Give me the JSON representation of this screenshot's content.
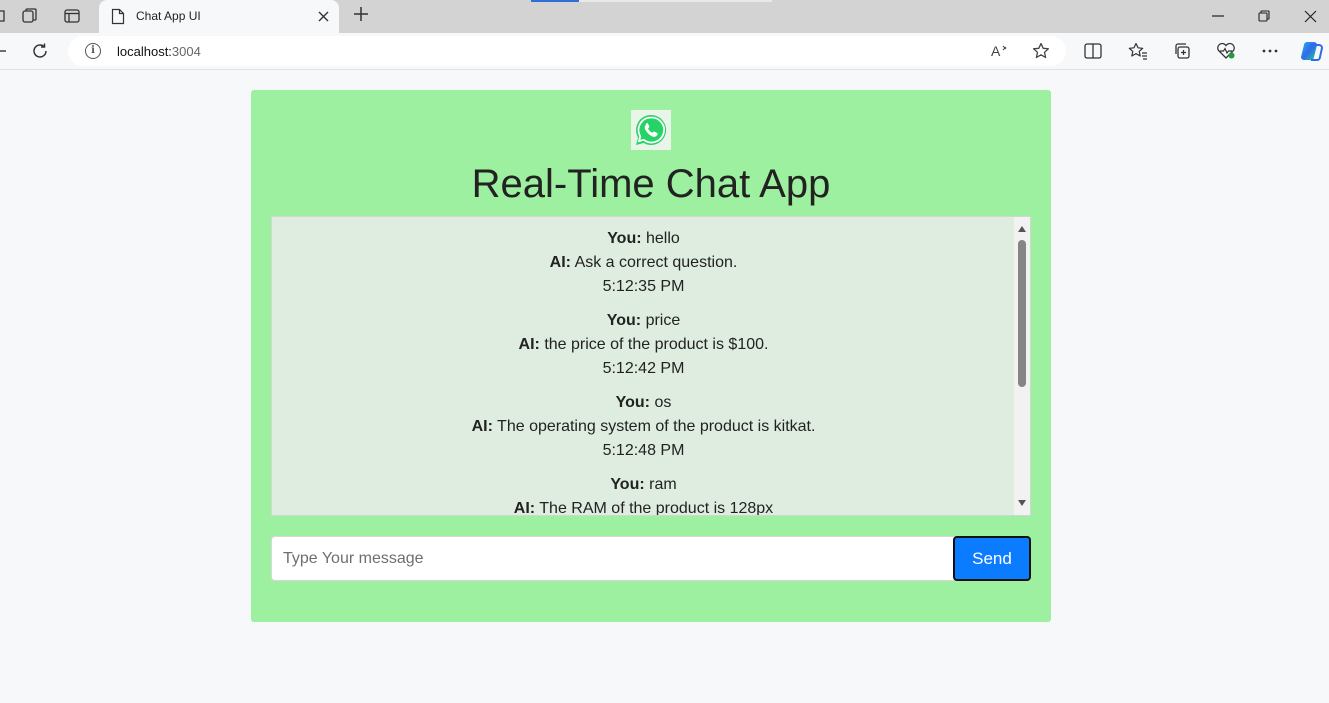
{
  "browser": {
    "tab_title": "Chat App UI",
    "url_host": "localhost:",
    "url_port": "3004"
  },
  "icons": {
    "workspaces": "workspaces-icon",
    "tab_actions": "tab-actions-icon",
    "page": "page-icon",
    "close": "close-icon",
    "new_tab": "plus-icon",
    "refresh": "refresh-icon",
    "info": "info-icon",
    "read_aloud": "read-aloud-icon",
    "favorite": "star-icon",
    "split": "split-screen-icon",
    "favorites": "favorites-icon",
    "collections": "collections-icon",
    "health": "browser-essentials-icon",
    "more": "more-icon",
    "copilot": "copilot-icon",
    "logo": "whatsapp-icon"
  },
  "colors": {
    "card": "#9cf09f",
    "chat_bg": "#dfede0",
    "send": "#0b7bff",
    "whatsapp": "#25d366"
  },
  "app": {
    "title": "Real-Time Chat App",
    "messages": [
      {
        "you_label": "You:",
        "you": "hello",
        "ai_label": "AI:",
        "ai": "Ask a correct question.",
        "time": "5:12:35 PM"
      },
      {
        "you_label": "You:",
        "you": "price",
        "ai_label": "AI:",
        "ai": "the price of the product is $100.",
        "time": "5:12:42 PM"
      },
      {
        "you_label": "You:",
        "you": "os",
        "ai_label": "AI:",
        "ai": "The operating system of the product is kitkat.",
        "time": "5:12:48 PM"
      },
      {
        "you_label": "You:",
        "you": "ram",
        "ai_label": "AI:",
        "ai": "The RAM of the product is 128px",
        "time": ""
      }
    ],
    "input_placeholder": "Type Your message",
    "send_label": "Send"
  }
}
